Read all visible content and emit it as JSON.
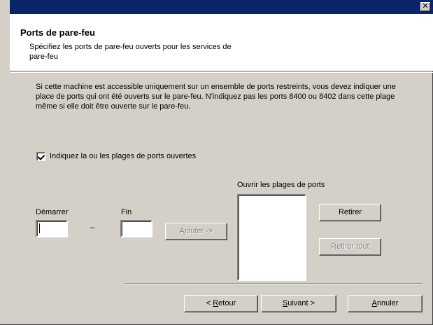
{
  "window": {
    "close_glyph": "✕"
  },
  "header": {
    "title": "Ports de pare-feu",
    "subtitle": "Spécifiez les ports de pare-feu ouverts pour les services de pare-feu"
  },
  "description": "Si cette machine est accessible uniquement sur un ensemble de ports restreints, vous devez indiquer une place de ports qui ont été ouverts sur le pare-feu. N'indiquez pas les ports 8400 ou 8402 dans cette plage même si elle doit être ouverte sur le pare-feu.",
  "checkbox": {
    "label": "Indiquez la ou les plages de ports ouvertes",
    "checked": true
  },
  "range": {
    "start_label": "Démarrer",
    "start_value": "",
    "dash": "–",
    "end_label": "Fin",
    "end_value": "",
    "add_button": "Ajouter ->",
    "open_ranges_label": "Ouvrir les plages de ports",
    "open_ranges": [],
    "remove_button": "Retirer",
    "remove_all_button": "Retirer tout"
  },
  "footer": {
    "back_prefix": "< ",
    "back_hotkey": "R",
    "back_rest": "etour",
    "next_hotkey": "S",
    "next_rest": "uivant >",
    "cancel_hotkey": "A",
    "cancel_rest": "nnuler"
  }
}
